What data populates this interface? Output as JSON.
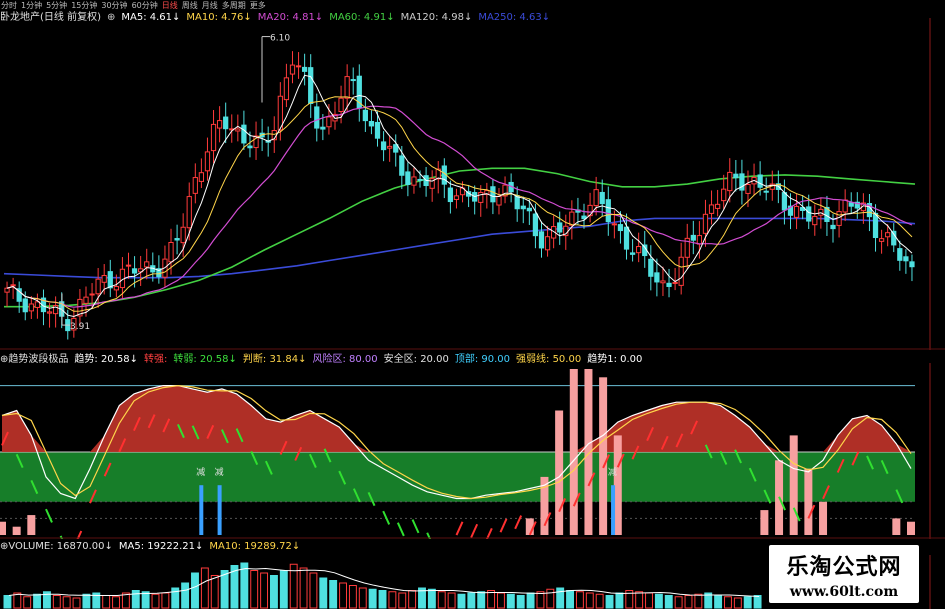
{
  "periods": [
    "分时",
    "1分钟",
    "5分钟",
    "15分钟",
    "30分钟",
    "60分钟",
    "日线",
    "周线",
    "月线",
    "多周期",
    "更多"
  ],
  "active_period": "日线",
  "main": {
    "title": "卧龙地产(日线 前复权)",
    "icon": "⊕",
    "ma5": "MA5: 4.61↓",
    "ma10": "MA10: 4.76↓",
    "ma20": "MA20: 4.81↓",
    "ma60": "MA60: 4.91↓",
    "ma120": "MA120: 4.98↓",
    "ma250": "MA250: 4.63↓",
    "high_label": "6.10",
    "low_label": "3.91"
  },
  "indicator": {
    "title": "⊕趋势波段极品",
    "trend": "趋势: 20.58↓",
    "turn_strong": "转强:",
    "turn_weak": "转弱: 20.58↓",
    "judge": "判断: 31.84↓",
    "risk_zone": "风险区: 80.00",
    "safe_zone": "安全区: 20.00",
    "top": "顶部: 90.00",
    "strong_weak_line": "强弱线: 50.00",
    "trend1": "趋势1: 0.00",
    "jian": "减"
  },
  "volume": {
    "volume": "⊕VOLUME: 16870.00↓",
    "ma5": "MA5: 19222.21↓",
    "ma10": "MA10: 19289.72↓"
  },
  "watermark": {
    "title": "乐淘公式网",
    "url": "www.60lt.com"
  },
  "colors": {
    "up": "#ff3b3b",
    "down": "#4fe0e0",
    "ma5": "#ffffff",
    "ma10": "#ffd54a",
    "ma20": "#d24dd2",
    "ma60": "#43d043",
    "ma250": "#3a4bd8",
    "red_area": "#b83228",
    "green_area": "#1a8c2e",
    "pink_bar": "#f7a0a0",
    "blue_bar": "#3aa0ff"
  },
  "chart_data": [
    {
      "type": "candlestick",
      "title": "卧龙地产(日线 前复权)",
      "max_price": 6.1,
      "min_price": 3.91,
      "close_path": [
        4.15,
        4.12,
        4.1,
        4.05,
        4.02,
        3.98,
        3.95,
        4.02,
        4.1,
        4.2,
        4.25,
        4.28,
        4.3,
        4.32,
        4.34,
        4.35,
        4.4,
        4.48,
        4.7,
        5.0,
        5.2,
        5.35,
        5.45,
        5.4,
        5.35,
        5.3,
        5.25,
        5.38,
        5.7,
        5.95,
        5.8,
        5.55,
        5.4,
        5.5,
        5.65,
        5.75,
        5.6,
        5.4,
        5.3,
        5.2,
        5.1,
        5.05,
        4.98,
        5.0,
        5.02,
        4.95,
        4.9,
        4.88,
        4.85,
        4.92,
        4.95,
        4.9,
        4.8,
        4.75,
        4.6,
        4.55,
        4.6,
        4.7,
        4.78,
        4.82,
        4.85,
        4.75,
        4.65,
        4.55,
        4.45,
        4.35,
        4.28,
        4.2,
        4.3,
        4.45,
        4.6,
        4.75,
        4.85,
        4.95,
        5.0,
        5.02,
        5.0,
        4.95,
        4.9,
        4.85,
        4.8,
        4.75,
        4.7,
        4.72,
        4.74,
        4.8,
        4.82,
        4.78,
        4.7,
        4.6,
        4.5,
        4.4,
        4.32
      ],
      "ma250": [
        4.3,
        4.29,
        4.28,
        4.27,
        4.27,
        4.27,
        4.28,
        4.3,
        4.33,
        4.36,
        4.4,
        4.44,
        4.48,
        4.52,
        4.56,
        4.6,
        4.62,
        4.64,
        4.66,
        4.7,
        4.72,
        4.72,
        4.72,
        4.72,
        4.72,
        4.72,
        4.71,
        4.7,
        4.68
      ],
      "ma60": [
        4.05,
        4.05,
        4.06,
        4.08,
        4.12,
        4.18,
        4.25,
        4.35,
        4.48,
        4.6,
        4.72,
        4.85,
        4.95,
        5.02,
        5.08,
        5.1,
        5.1,
        5.06,
        5.0,
        4.96,
        4.96,
        4.98,
        5.02,
        5.04,
        5.05,
        5.04,
        5.02,
        5.0,
        4.98
      ]
    },
    {
      "type": "area",
      "title": "趋势波段极品",
      "ylim": [
        0,
        100
      ],
      "reference_lines": {
        "risk_zone": 80,
        "safe_zone": 20,
        "top": 90,
        "strong_weak_line": 50
      },
      "trend": [
        72,
        75,
        60,
        35,
        25,
        22,
        40,
        60,
        78,
        85,
        88,
        90,
        90,
        88,
        86,
        88,
        85,
        78,
        70,
        68,
        72,
        75,
        70,
        65,
        55,
        45,
        40,
        35,
        30,
        26,
        24,
        22,
        22,
        24,
        25,
        26,
        28,
        30,
        35,
        45,
        55,
        60,
        68,
        72,
        75,
        78,
        80,
        80,
        80,
        78,
        72,
        65,
        55,
        45,
        40,
        38,
        45,
        60,
        70,
        72,
        66,
        55,
        40
      ],
      "strong_bars": [
        2,
        3,
        4,
        5,
        6,
        7,
        8,
        9,
        10,
        11,
        12,
        13,
        14,
        15,
        16,
        17,
        18,
        19,
        20,
        21,
        22,
        23,
        24,
        25,
        26,
        27,
        28,
        29,
        30
      ],
      "pink_bars": [
        8,
        5,
        12,
        0,
        0,
        0,
        0,
        0,
        0,
        0,
        0,
        0,
        0,
        0,
        0,
        0,
        0,
        0,
        0,
        0,
        0,
        0,
        0,
        0,
        0,
        0,
        0,
        0,
        0,
        0,
        0,
        0,
        0,
        0,
        0,
        0,
        10,
        35,
        75,
        100,
        100,
        95,
        60,
        0,
        0,
        0,
        0,
        0,
        0,
        0,
        0,
        0,
        15,
        45,
        60,
        40,
        20,
        0,
        0,
        0,
        0,
        10,
        8
      ],
      "blue_bar_positions": [
        0.22,
        0.24,
        0.67
      ],
      "jian_positions": [
        0.22,
        0.24,
        0.67
      ]
    },
    {
      "type": "bar",
      "title": "VOLUME",
      "values": [
        10,
        12,
        9,
        11,
        13,
        10,
        9,
        8,
        11,
        12,
        10,
        9,
        12,
        14,
        13,
        11,
        12,
        16,
        20,
        28,
        32,
        26,
        30,
        34,
        36,
        30,
        28,
        26,
        30,
        35,
        32,
        28,
        24,
        22,
        20,
        18,
        16,
        15,
        14,
        13,
        12,
        14,
        16,
        15,
        13,
        12,
        11,
        12,
        13,
        14,
        12,
        11,
        10,
        12,
        13,
        15,
        16,
        14,
        13,
        12,
        11,
        10,
        12,
        14,
        13,
        12,
        11,
        10,
        9,
        10,
        11,
        12,
        10,
        9,
        8,
        9,
        10
      ]
    }
  ]
}
